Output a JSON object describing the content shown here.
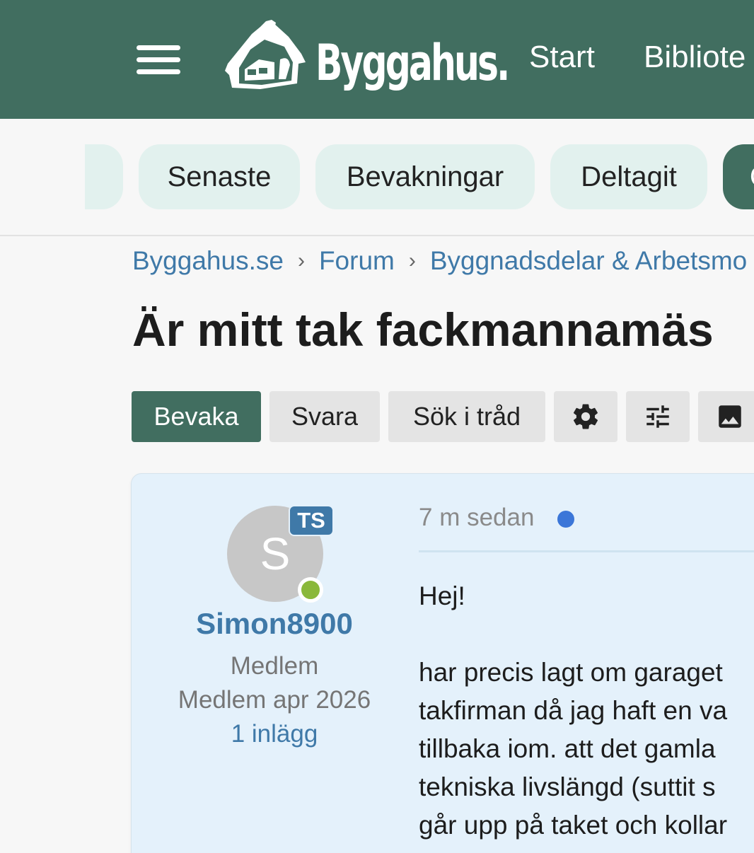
{
  "header": {
    "logo_text": "Byggahus.",
    "nav": [
      "Start",
      "Bibliote"
    ]
  },
  "tabs": [
    "Senaste",
    "Bevakningar",
    "Deltagit",
    "O"
  ],
  "breadcrumb": [
    "Byggahus.se",
    "Forum",
    "Byggnadsdelar & Arbetsmo"
  ],
  "thread": {
    "title": "Är mitt tak fackmannamäs"
  },
  "actions": {
    "watch": "Bevaka",
    "reply": "Svara",
    "search": "Sök i tråd"
  },
  "post": {
    "avatar_letter": "S",
    "badge": "TS",
    "username": "Simon8900",
    "role": "Medlem",
    "member_since": "Medlem apr 2026",
    "post_count": "1 inlägg",
    "time": "7 m sedan",
    "greeting": "Hej!",
    "lines": [
      "har precis lagt om garaget",
      "takfirman då jag haft en va",
      "tillbaka iom. att det gamla",
      "tekniska livslängd (suttit s",
      "går upp på taket och kollar"
    ]
  },
  "colors": {
    "brand": "#416e60",
    "link": "#3f79a8",
    "post_bg": "#e4f1fb",
    "online": "#8ab83a",
    "unread": "#3b76d8"
  },
  "icons": [
    "menu-icon",
    "house-logo-icon",
    "gear-icon",
    "sliders-icon",
    "image-icon"
  ]
}
